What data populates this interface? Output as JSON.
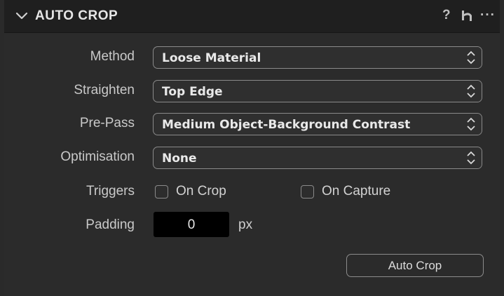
{
  "header": {
    "title": "AUTO CROP",
    "collapse_icon": "chevron-down-icon",
    "help_icon": "?",
    "reset_icon": "reset-icon",
    "more_icon": "···"
  },
  "method": {
    "label": "Method",
    "value": "Loose Material"
  },
  "straighten": {
    "label": "Straighten",
    "value": "Top Edge"
  },
  "prepass": {
    "label": "Pre-Pass",
    "value": "Medium Object-Background Contrast"
  },
  "optimisation": {
    "label": "Optimisation",
    "value": "None"
  },
  "triggers": {
    "label": "Triggers",
    "on_crop": {
      "label": "On Crop",
      "checked": false
    },
    "on_capture": {
      "label": "On Capture",
      "checked": false
    }
  },
  "padding": {
    "label": "Padding",
    "value": "0",
    "unit": "px"
  },
  "actions": {
    "auto_crop_label": "Auto Crop"
  },
  "colors": {
    "panel_bg": "#2b2b2b",
    "header_bg": "#1f1f1f",
    "field_bg": "#000000",
    "border": "#8a8a8a"
  }
}
